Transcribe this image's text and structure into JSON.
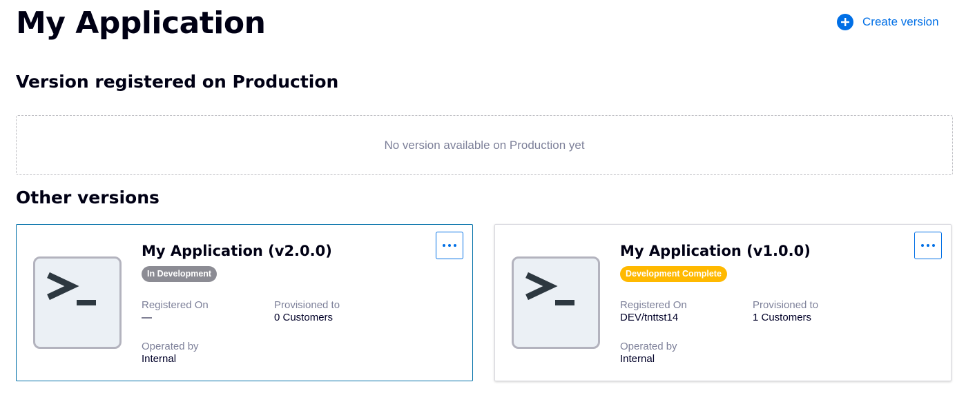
{
  "page": {
    "title": "My Application",
    "create_version_label": "Create version"
  },
  "production": {
    "heading": "Version registered on Production",
    "empty_message": "No version available on Production yet"
  },
  "other_versions": {
    "heading": "Other versions",
    "cards": [
      {
        "title": "My Application (v2.0.0)",
        "status": "In Development",
        "status_color": "#8c8c94",
        "registered_on_label": "Registered On",
        "registered_on_value": "—",
        "provisioned_label": "Provisioned to",
        "provisioned_value": "0 Customers",
        "operated_label": "Operated by",
        "operated_value": "Internal",
        "selected": true
      },
      {
        "title": "My Application (v1.0.0)",
        "status": "Development Complete",
        "status_color": "#ffb900",
        "registered_on_label": "Registered On",
        "registered_on_value": "DEV/tnttst14",
        "provisioned_label": "Provisioned to",
        "provisioned_value": "1 Customers",
        "operated_label": "Operated by",
        "operated_value": "Internal",
        "selected": false
      }
    ]
  },
  "icons": {
    "create": "plus-circle-icon",
    "app": "terminal-icon",
    "more": "more-horizontal-icon"
  },
  "colors": {
    "accent": "#006fe6",
    "selected_border": "#006fa8"
  }
}
